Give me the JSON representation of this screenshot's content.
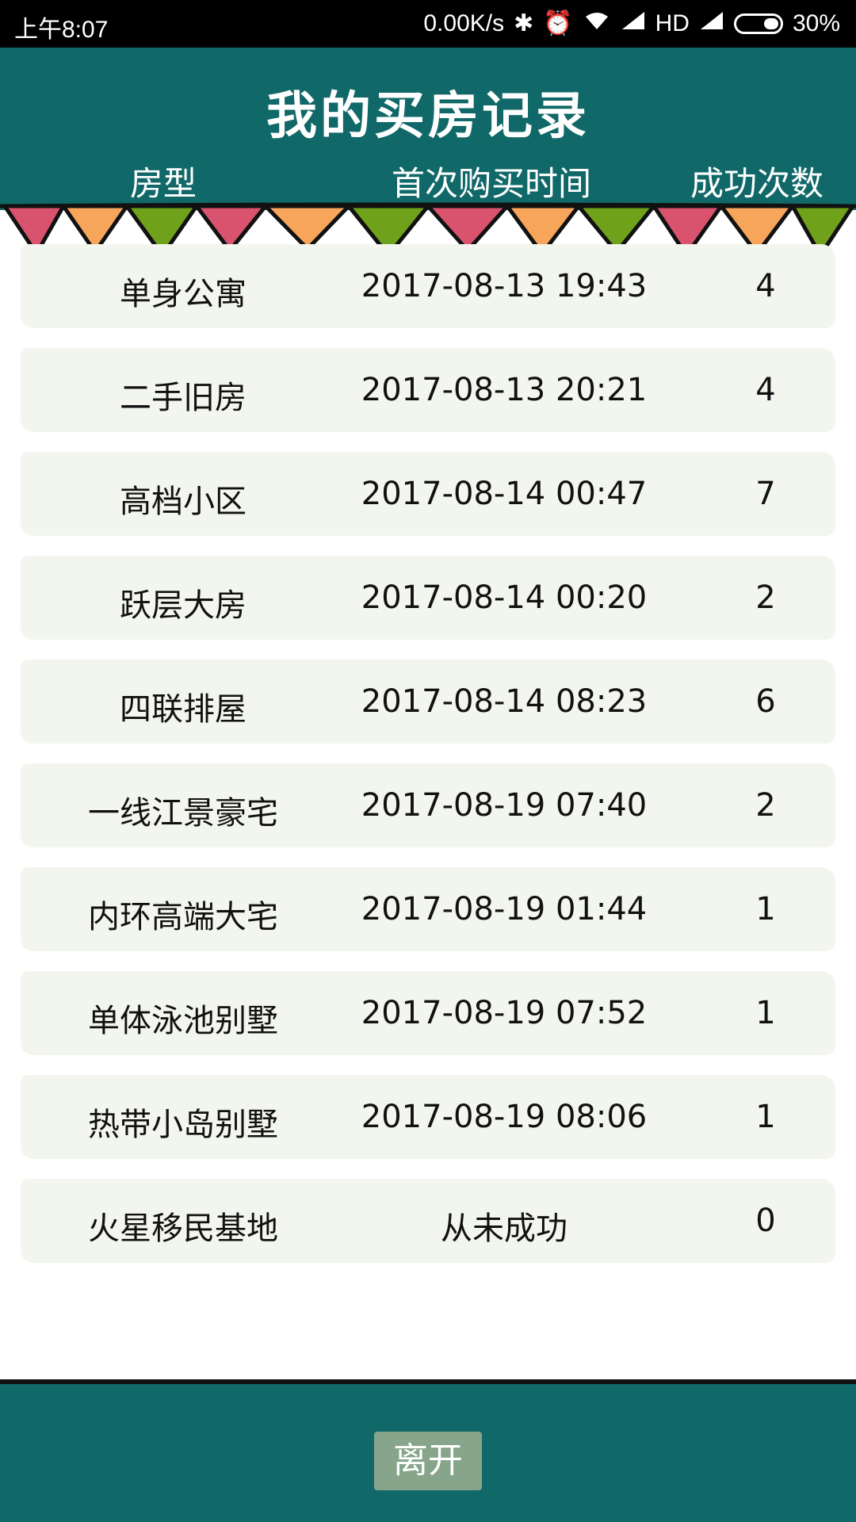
{
  "status_bar": {
    "time": "上午8:07",
    "network_speed": "0.00K/s",
    "hd": "HD",
    "battery": "30%",
    "icons": [
      "bluetooth-icon",
      "alarm-icon",
      "wifi-icon",
      "signal-icon",
      "signal-icon-2",
      "battery-icon"
    ]
  },
  "header": {
    "title": "我的买房记录",
    "columns": [
      "房型",
      "首次购买时间",
      "成功次数"
    ]
  },
  "rows": [
    {
      "type": "单身公寓",
      "time": "2017-08-13 19:43",
      "count": "4"
    },
    {
      "type": "二手旧房",
      "time": "2017-08-13 20:21",
      "count": "4"
    },
    {
      "type": "高档小区",
      "time": "2017-08-14 00:47",
      "count": "7"
    },
    {
      "type": "跃层大房",
      "time": "2017-08-14 00:20",
      "count": "2"
    },
    {
      "type": "四联排屋",
      "time": "2017-08-14 08:23",
      "count": "6"
    },
    {
      "type": "一线江景豪宅",
      "time": "2017-08-19 07:40",
      "count": "2"
    },
    {
      "type": "内环高端大宅",
      "time": "2017-08-19 01:44",
      "count": "1"
    },
    {
      "type": "单体泳池别墅",
      "time": "2017-08-19 07:52",
      "count": "1"
    },
    {
      "type": "热带小岛别墅",
      "time": "2017-08-19 08:06",
      "count": "1"
    },
    {
      "type": "火星移民基地",
      "time": "从未成功",
      "count": "0"
    }
  ],
  "footer": {
    "leave_label": "离开"
  },
  "colors": {
    "header_bg": "#116868",
    "row_bg": "#f3f6ee",
    "button_bg": "#86a58a",
    "flag_pink": "#d9536f",
    "flag_orange": "#f6a55b",
    "flag_green": "#6fa11a"
  }
}
